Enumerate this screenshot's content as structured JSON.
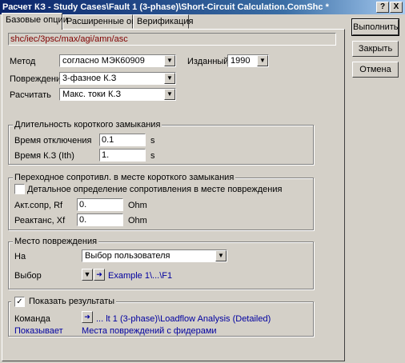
{
  "window": {
    "title": "Расчет КЗ - Study Cases\\Fault 1 (3-phase)\\Short-Circuit Calculation.ComShc *",
    "help_label": "?",
    "close_label": "X"
  },
  "tabs": [
    {
      "label": "Базовые опции"
    },
    {
      "label": "Расширенные опции"
    },
    {
      "label": "Верификация"
    }
  ],
  "side_buttons": {
    "execute": "Выполнить",
    "close": "Закрыть",
    "cancel": "Отмена"
  },
  "path": "shc/iec/3psc/max/agi/amn/asc",
  "method": {
    "label": "Метод",
    "value": "согласно МЭК60909"
  },
  "edition": {
    "label": "Изданный",
    "value": "1990"
  },
  "fault_type": {
    "label": "Повреждение",
    "value": "3-фазное К.З"
  },
  "calculate": {
    "label": "Расчитать",
    "value": "Макс. токи К.З"
  },
  "duration": {
    "title": "Длительность короткого замыкания",
    "clear_label": "Время отключения",
    "clear_value": "0.1",
    "clear_unit": "s",
    "tk_label": "Время К.З (Ith)",
    "tk_value": "1.",
    "tk_unit": "s"
  },
  "resistance": {
    "title": "Переходное сопротивл. в месте короткого замыкания",
    "detail_label": "Детальное определение сопротивления в месте повреждения",
    "detail_checked": false,
    "rf_label": "Акт.сопр, Rf",
    "rf_value": "0.",
    "rf_unit": "Ohm",
    "xf_label": "Реактанс, Xf",
    "xf_value": "0.",
    "xf_unit": "Ohm"
  },
  "location": {
    "title": "Место повреждения",
    "at_label": "На",
    "at_value": "Выбор пользователя",
    "select_label": "Выбор",
    "select_value": "Example 1\\...\\F1"
  },
  "output": {
    "show_label": "Показать результаты",
    "show_checked": true,
    "command_label": "Команда",
    "command_value": "... lt 1 (3-phase)\\Loadflow Analysis (Detailed)",
    "shows_label": "Показывает",
    "shows_value": "Места повреждений с фидерами"
  }
}
